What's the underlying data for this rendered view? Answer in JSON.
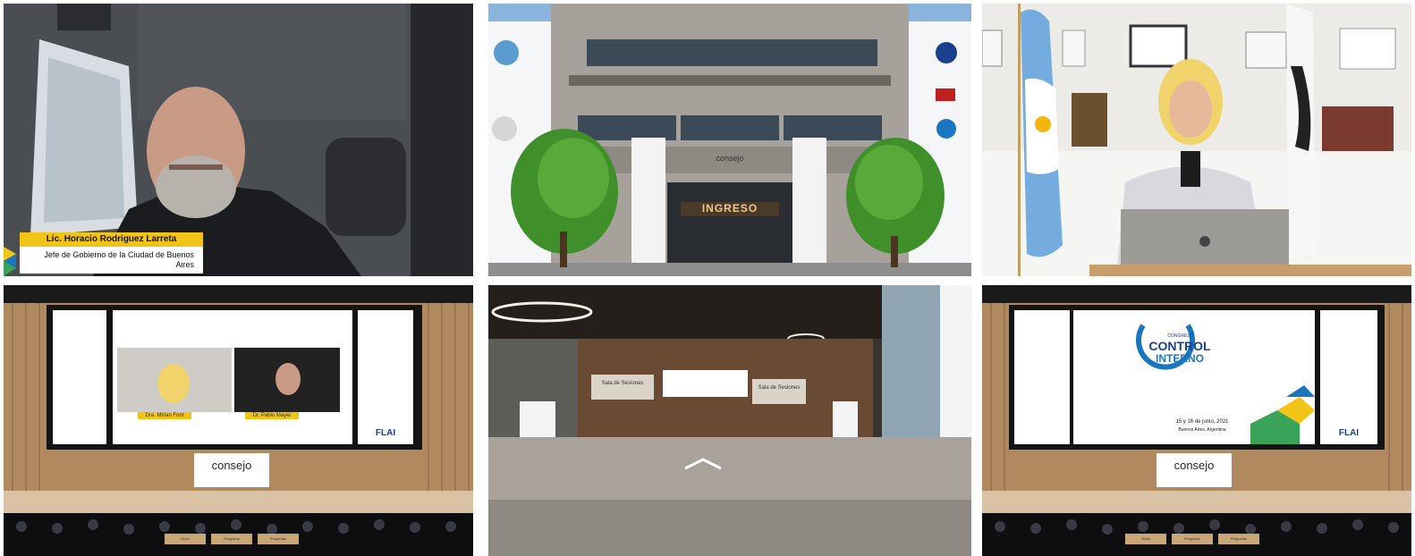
{
  "tiles": {
    "speaker_caption": {
      "name": "Lic. Horacio Rodriguez Larreta",
      "role": "Jefe de Gobierno de la Ciudad de Buenos Aires"
    },
    "building": {
      "entrance_sign": "INGRESO",
      "brand": "consejo"
    },
    "stage_left": {
      "brand": "consejo",
      "sponsor": "FLAI",
      "panelist_1": "Dra. Mirian Font",
      "panelist_2": "Dr. Pablo Mayer",
      "buttons": [
        "Video",
        "Programa",
        "Preguntas"
      ]
    },
    "lobby": {
      "sign_1": "Sala de Sesiones",
      "sign_2": "Sala de Sesiones"
    },
    "stage_right": {
      "brand": "consejo",
      "sponsor": "FLAI",
      "event_line1": "CONGRESO",
      "event_title1": "CONTROL",
      "event_title2": "INTERNO",
      "event_date": "15 y 16 de junio, 2021",
      "event_place": "Buenos Aires, Argentina",
      "buttons": [
        "Video",
        "Programa",
        "Preguntas"
      ]
    }
  },
  "colors": {
    "caption_yellow": "#f2c418",
    "brand_blue": "#1a76bf",
    "wood": "#b08a5e",
    "argentina_blue": "#74acdf"
  }
}
